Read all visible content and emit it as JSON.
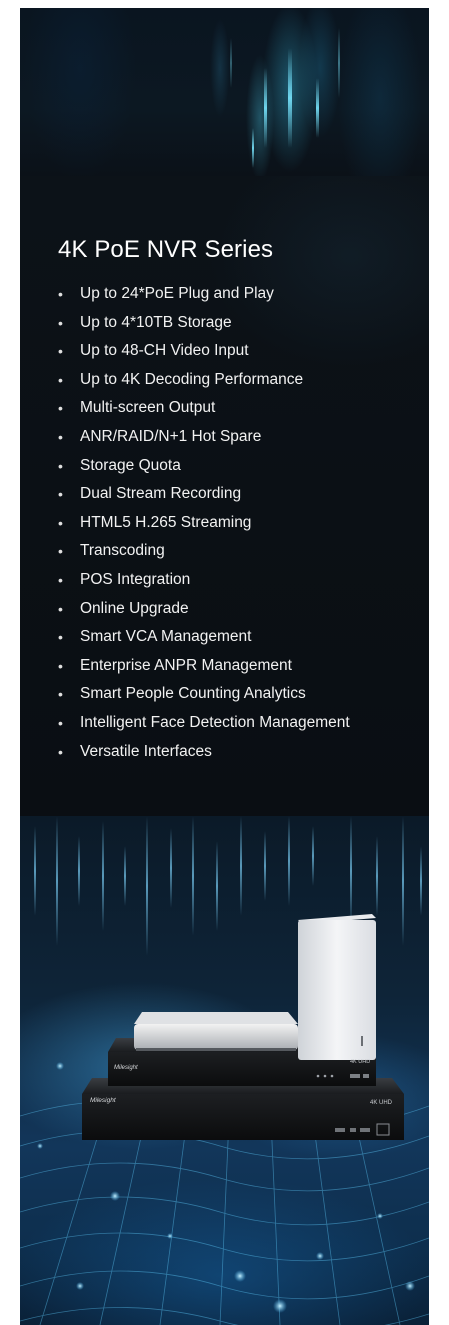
{
  "banner": {
    "title": "4K PoE NVR Series",
    "bullet_glyph": "•",
    "features": [
      "Up to 24*PoE Plug and Play",
      "Up to 4*10TB Storage",
      "Up to 48-CH Video Input",
      "Up to 4K Decoding Performance",
      "Multi-screen Output",
      "ANR/RAID/N+1 Hot Spare",
      "Storage Quota",
      "Dual Stream Recording",
      "HTML5 H.265 Streaming",
      "Transcoding",
      "POS Integration",
      "Online Upgrade",
      "Smart VCA Management",
      "Enterprise ANPR Management",
      "Smart People Counting Analytics",
      "Intelligent Face Detection Management",
      "Versatile Interfaces"
    ]
  },
  "products": {
    "brand_mark": "Milesight",
    "model_badge": "4K UHD"
  },
  "colors": {
    "panel_background": "#0b1016",
    "title_text": "#ffffff",
    "feature_text": "#f2f2f2",
    "glow_accent": "#4fd2ff"
  }
}
